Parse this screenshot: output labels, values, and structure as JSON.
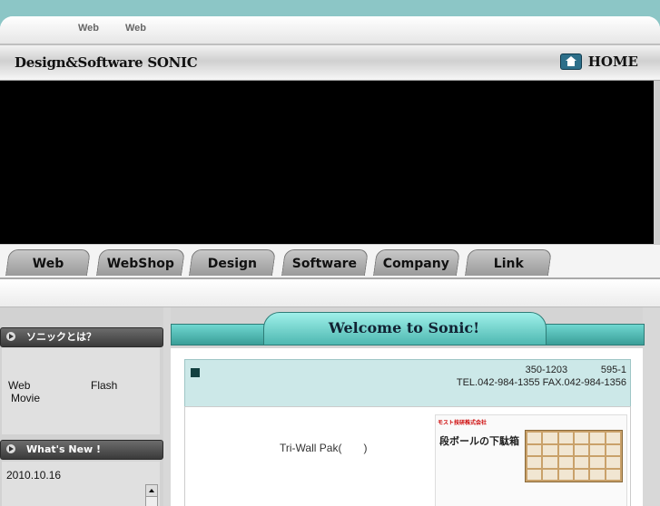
{
  "top_links": [
    "Web",
    "Web"
  ],
  "header": {
    "logo": "Design&Software SONIC",
    "home_label": "HOME"
  },
  "nav": [
    "Web",
    "WebShop",
    "Design",
    "Software",
    "Company",
    "Link"
  ],
  "sidebar": {
    "about_title": "ソニックとは？",
    "about_items": [
      "Web",
      "Flash",
      "Movie"
    ],
    "news_title": "What's New !",
    "news_date": "2010.10.16"
  },
  "main": {
    "welcome": "Welcome to Sonic!",
    "postal": "350-1203",
    "address_no": "595-1",
    "tel_fax": "TEL.042-984-1355 FAX.042-984-1356",
    "product_text": "Tri-Wall Pak(　　)",
    "thumb_title": "段ボールの下駄箱",
    "thumb_logo": "モスト技研株式会社"
  }
}
